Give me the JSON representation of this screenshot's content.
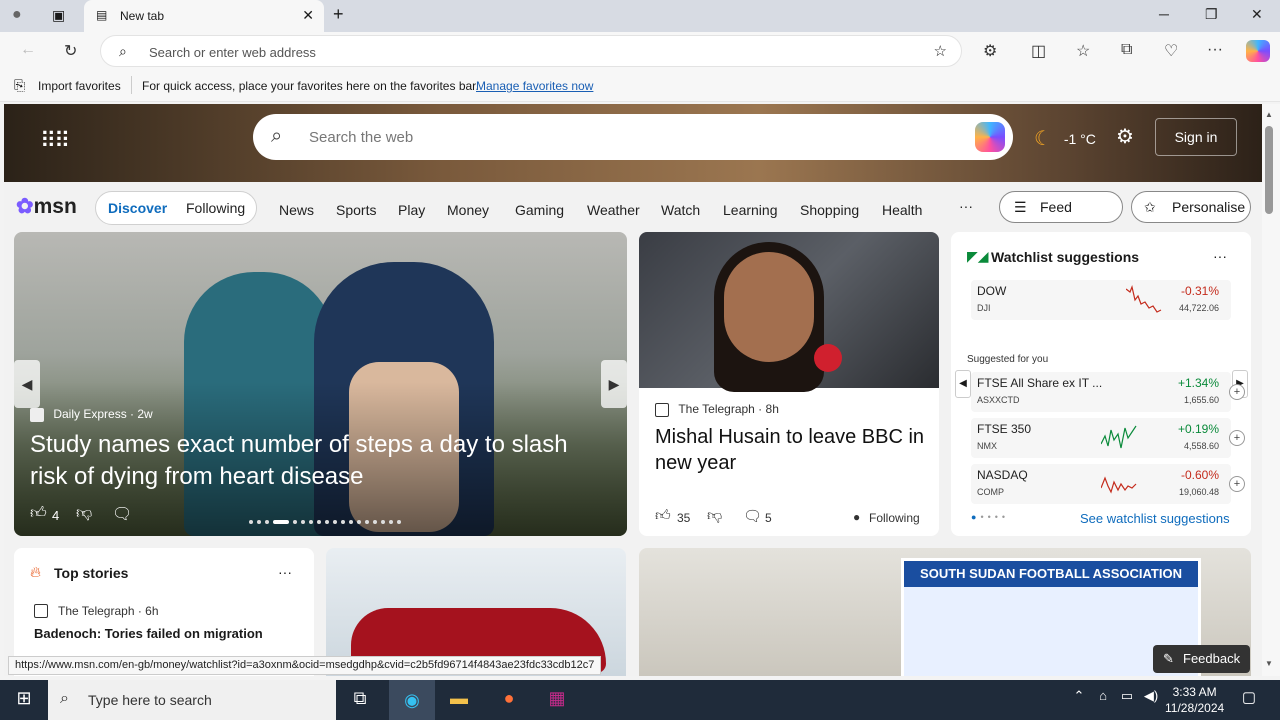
{
  "browser": {
    "tab_title": "New tab",
    "address_placeholder": "Search or enter web address",
    "fav_import": "Import favorites",
    "fav_message": "For quick access, place your favorites here on the favorites bar.",
    "fav_manage_link": "Manage favorites now",
    "status_url": "https://www.msn.com/en-gb/money/watchlist?id=a3oxnm&ocid=msedgdhp&cvid=c2b5fd96714f4843ae23fdc33cdb12c7"
  },
  "header": {
    "search_placeholder": "Search the web",
    "weather": "-1 °C",
    "signin": "Sign in"
  },
  "nav": {
    "logo": "msn",
    "discover": "Discover",
    "following": "Following",
    "items": [
      "News",
      "Sports",
      "Play",
      "Money",
      "Gaming",
      "Weather",
      "Watch",
      "Learning",
      "Shopping",
      "Health"
    ],
    "more": "···",
    "feed_layout": "Feed layout",
    "personalise": "Personalise"
  },
  "lead_story": {
    "source": "Daily Express",
    "age": "2w",
    "title": "Study names exact number of steps a day to slash risk of dying from heart disease",
    "likes": "4"
  },
  "story2": {
    "source": "The Telegraph",
    "age": "8h",
    "title": "Mishal Husain to leave BBC in new year",
    "likes": "35",
    "comments": "5",
    "following": "Following"
  },
  "watchlist": {
    "title": "Watchlist suggestions",
    "suggested_label": "Suggested for you",
    "see_more": "See watchlist suggestions",
    "rows": [
      {
        "name": "DOW",
        "symbol": "DJI",
        "change": "-0.31%",
        "value": "44,722.06",
        "trend": "down"
      },
      {
        "name": "FTSE All Share ex IT ...",
        "symbol": "ASXXCTD",
        "change": "+1.34%",
        "value": "1,655.60",
        "trend": "up"
      },
      {
        "name": "FTSE 350",
        "symbol": "NMX",
        "change": "+0.19%",
        "value": "4,558.60",
        "trend": "up"
      },
      {
        "name": "NASDAQ",
        "symbol": "COMP",
        "change": "-0.60%",
        "value": "19,060.48",
        "trend": "down"
      }
    ],
    "colors": {
      "up": "#0a8a3a",
      "down": "#c42b1c"
    }
  },
  "top_stories": {
    "title": "Top stories",
    "source": "The Telegraph",
    "age": "6h",
    "headline": "Badenoch: Tories failed on migration"
  },
  "football": {
    "banner": "SOUTH SUDAN FOOTBALL ASSOCIATION"
  },
  "feedback": "Feedback",
  "taskbar": {
    "search_placeholder": "Type here to search",
    "time": "3:33 AM",
    "date": "11/28/2024"
  }
}
